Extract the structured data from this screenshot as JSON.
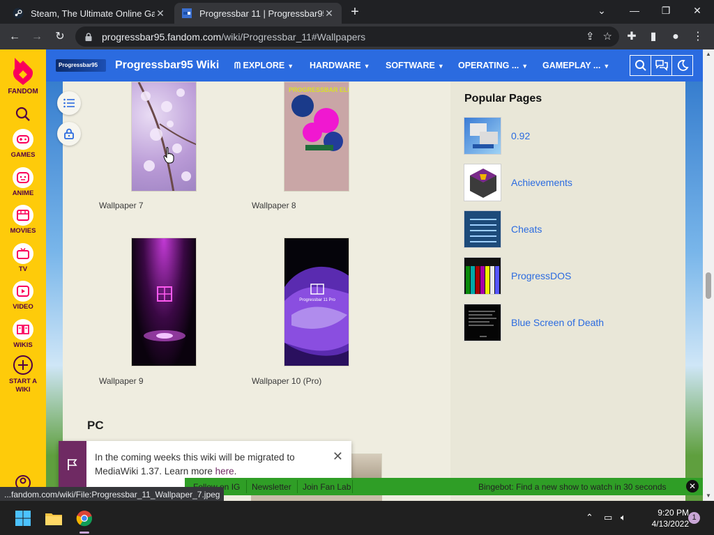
{
  "browser": {
    "tabs": [
      {
        "title": "Steam, The Ultimate Online Game Platform"
      },
      {
        "title": "Progressbar 11 | Progressbar95 Wiki"
      }
    ],
    "address": {
      "host": "progressbar95.fandom.com",
      "path": "/wiki/Progressbar_11#Wallpapers"
    },
    "status_url": "...fandom.com/wiki/File:Progressbar_11_Wallpaper_7.jpeg"
  },
  "fandom_rail": {
    "brand": "FANDOM",
    "items": [
      {
        "label": "GAMES"
      },
      {
        "label": "ANIME"
      },
      {
        "label": "MOVIES"
      },
      {
        "label": "TV"
      },
      {
        "label": "VIDEO"
      },
      {
        "label": "WIKIS"
      },
      {
        "label": "START A WIKI"
      }
    ]
  },
  "wiki": {
    "title": "Progressbar95 Wiki",
    "logo_text": "Progressbar95",
    "nav": [
      {
        "label": "EXPLORE"
      },
      {
        "label": "HARDWARE"
      },
      {
        "label": "SOFTWARE"
      },
      {
        "label": "OPERATING ..."
      },
      {
        "label": "GAMEPLAY ..."
      }
    ]
  },
  "gallery": {
    "items": [
      {
        "caption": "Wallpaper 7"
      },
      {
        "caption": "Wallpaper 8"
      },
      {
        "caption": "Wallpaper 9"
      },
      {
        "caption": "Wallpaper 10 (Pro)"
      }
    ],
    "wallpaper8_text": "PROGRESSBAR ELEVEN",
    "wallpaper10_text": "Progressbar 11 Pro",
    "next_section": "PC"
  },
  "popular_pages": {
    "title": "Popular Pages",
    "items": [
      {
        "label": "0.92"
      },
      {
        "label": "Achievements"
      },
      {
        "label": "Cheats"
      },
      {
        "label": "ProgressDOS"
      },
      {
        "label": "Blue Screen of Death"
      }
    ]
  },
  "notice": {
    "text": "In the coming weeks this wiki will be migrated to MediaWiki 1.37. Learn more ",
    "link": "here",
    "end": "."
  },
  "green_bar": {
    "links": [
      {
        "label": "Follow on IG"
      },
      {
        "label": "Newsletter"
      },
      {
        "label": "Join Fan Lab"
      }
    ],
    "promo": "Bingebot: Find a new show to watch in 30 seconds"
  },
  "taskbar": {
    "time": "9:20 PM",
    "date": "4/13/2022",
    "notifications": "1"
  },
  "colors": {
    "fandom_yellow": "#fecb0a",
    "wiki_blue": "#2b6be0",
    "content_bg": "#efede0",
    "link": "#2b6be0",
    "notice_purple": "#6f2a63",
    "green_bar": "#2f9e26"
  }
}
